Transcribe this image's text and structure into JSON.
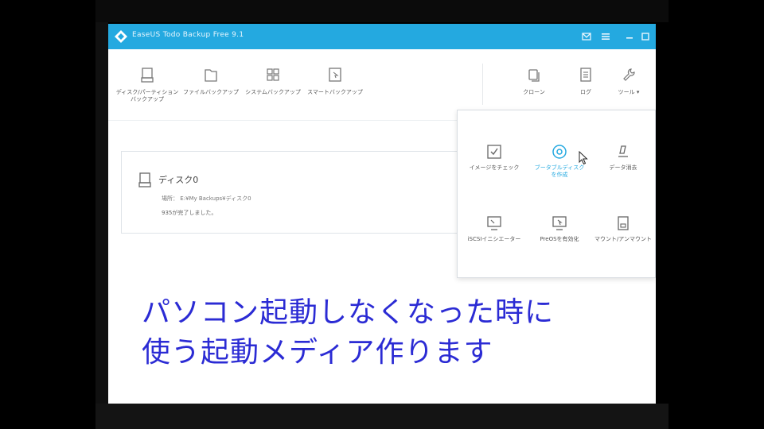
{
  "window": {
    "title": "EaseUS Todo Backup Free 9.1"
  },
  "toolbar": {
    "items": [
      {
        "label": "ディスク/パーティション\nバックアップ",
        "icon": "disk-icon"
      },
      {
        "label": "ファイルバックアップ",
        "icon": "folder-icon"
      },
      {
        "label": "システムバックアップ",
        "icon": "windows-icon"
      },
      {
        "label": "スマートバックアップ",
        "icon": "cursor-box-icon"
      }
    ],
    "right_items": [
      {
        "label": "クローン",
        "icon": "clone-icon"
      },
      {
        "label": "ログ",
        "icon": "log-icon"
      },
      {
        "label": "ツール ▾",
        "icon": "wrench-icon"
      }
    ]
  },
  "backup_card": {
    "name": "ディスク0",
    "target": "場所： E:¥My Backups¥ディスク0",
    "status": "935が完了しました。"
  },
  "tools_menu": {
    "items": [
      {
        "label": "イメージをチェック",
        "icon": "check-image-icon",
        "active": false
      },
      {
        "label": "ブータブルディスク\nを作成",
        "icon": "bootable-disc-icon",
        "active": true
      },
      {
        "label": "データ消去",
        "icon": "eraser-icon",
        "active": false
      },
      {
        "label": "iSCSIイニシエーター",
        "icon": "iscsi-icon",
        "active": false
      },
      {
        "label": "PreOSを有効化",
        "icon": "preos-icon",
        "active": false
      },
      {
        "label": "マウント/アンマウント",
        "icon": "mount-icon",
        "active": false
      }
    ]
  },
  "subtitles": {
    "line1": "パソコン起動しなくなった時に",
    "line2": "使う起動メディア作ります"
  },
  "colors": {
    "titlebar": "#24a9e0",
    "accent": "#24a9e0",
    "subtitle": "#2b2bd4"
  }
}
